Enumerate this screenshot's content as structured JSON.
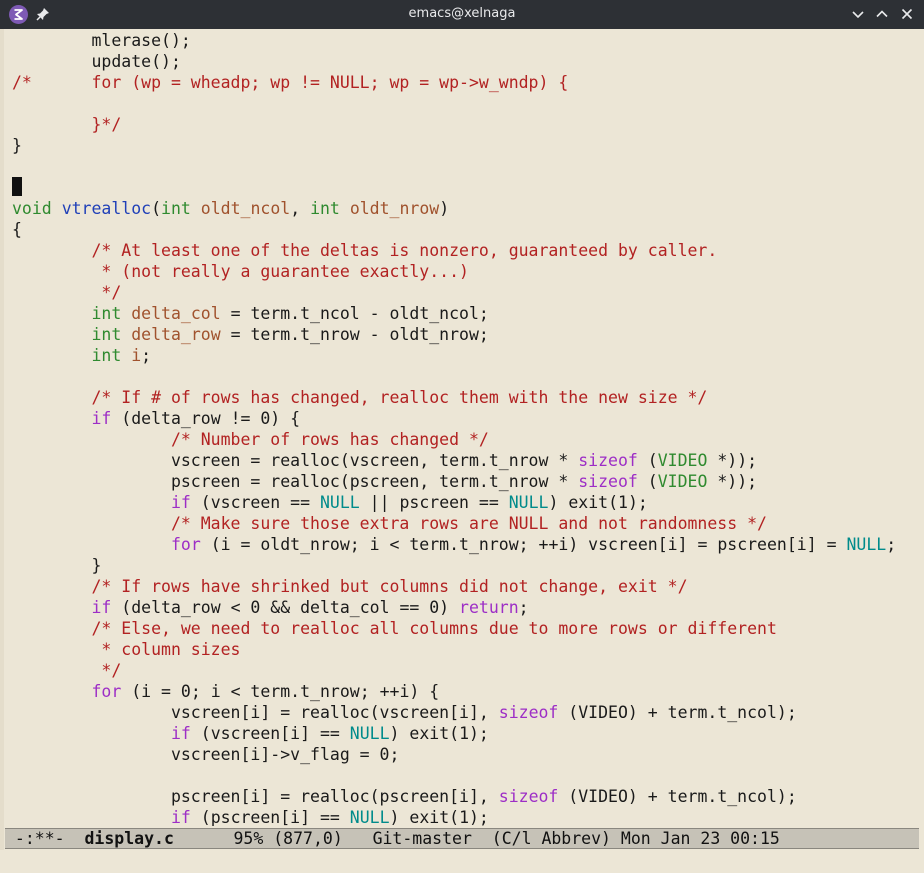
{
  "window": {
    "title": "emacs@xelnaga",
    "icons": {
      "app": "emacs-logo-icon",
      "pin": "pin-icon",
      "minimize": "chevron-down-icon",
      "maximize": "chevron-up-icon",
      "close": "close-icon"
    }
  },
  "colors": {
    "background": "#ece6d6",
    "keyword": "#9d2ec6",
    "type": "#2f8a2f",
    "variable": "#a0522d",
    "function": "#2040b8",
    "comment": "#b22222",
    "constant": "#008b8b",
    "modeline": "#c6c2b7"
  },
  "code": {
    "l1": [
      "        mlerase();"
    ],
    "l2": [
      "        update();"
    ],
    "l3": [
      "/*      for (wp = wheadp; wp != NULL; wp = wp->w_wndp) {"
    ],
    "l5": [
      "        }*/"
    ],
    "l6": [
      "}"
    ],
    "l9": [
      "void",
      " ",
      "vtrealloc",
      "(",
      "int",
      " ",
      "oldt_ncol",
      ", ",
      "int",
      " ",
      "oldt_nrow",
      ")"
    ],
    "l10": [
      "{"
    ],
    "l11": [
      "        /* At least one of the deltas is nonzero, guaranteed by caller."
    ],
    "l12": [
      "         * (not really a guarantee exactly...)"
    ],
    "l13": [
      "         */"
    ],
    "l14": [
      "        ",
      "int",
      " ",
      "delta_col",
      " = term.t_ncol - oldt_ncol;"
    ],
    "l15": [
      "        ",
      "int",
      " ",
      "delta_row",
      " = term.t_nrow - oldt_nrow;"
    ],
    "l16": [
      "        ",
      "int",
      " ",
      "i",
      ";"
    ],
    "l18": [
      "        /* If # of rows has changed, realloc them with the new size */"
    ],
    "l19": [
      "        ",
      "if",
      " (delta_row != 0) {"
    ],
    "l20": [
      "                /* Number of rows has changed */"
    ],
    "l21": [
      "                vscreen = realloc(vscreen, term.t_nrow * ",
      "sizeof",
      " (",
      "VIDEO",
      " *));"
    ],
    "l22": [
      "                pscreen = realloc(pscreen, term.t_nrow * ",
      "sizeof",
      " (",
      "VIDEO",
      " *));"
    ],
    "l23": [
      "                ",
      "if",
      " (vscreen == ",
      "NULL",
      " || pscreen == ",
      "NULL",
      ") exit(1);"
    ],
    "l24": [
      "                /* Make sure those extra rows are NULL and not randomness */"
    ],
    "l25": [
      "                ",
      "for",
      " (i = oldt_nrow; i < term.t_nrow; ++i) vscreen[i] = pscreen[i] = ",
      "NULL",
      ";"
    ],
    "l26": [
      "        }"
    ],
    "l27": [
      "        /* If rows have shrinked but columns did not change, exit */"
    ],
    "l28": [
      "        ",
      "if",
      " (delta_row < 0 && delta_col == 0) ",
      "return",
      ";"
    ],
    "l29": [
      "        /* Else, we need to realloc all columns due to more rows or different"
    ],
    "l30": [
      "         * column sizes"
    ],
    "l31": [
      "         */"
    ],
    "l32": [
      "        ",
      "for",
      " (i = 0; i < term.t_nrow; ++i) {"
    ],
    "l33": [
      "                vscreen[i] = realloc(vscreen[i], ",
      "sizeof",
      " (VIDEO) + term.t_ncol);"
    ],
    "l34": [
      "                ",
      "if",
      " (vscreen[i] == ",
      "NULL",
      ") exit(1);"
    ],
    "l35": [
      "                vscreen[i]->v_flag = 0;"
    ],
    "l37": [
      "                pscreen[i] = realloc(pscreen[i], ",
      "sizeof",
      " (VIDEO) + term.t_ncol);"
    ],
    "l38": [
      "                ",
      "if",
      " (pscreen[i] == ",
      "NULL",
      ") exit(1);"
    ]
  },
  "modeline": {
    "status": " -:**-  ",
    "buffer": "display.c",
    "position": "      95% (877,0)   Git-master  (C/l Abbrev) Mon Jan 23 00:15"
  }
}
